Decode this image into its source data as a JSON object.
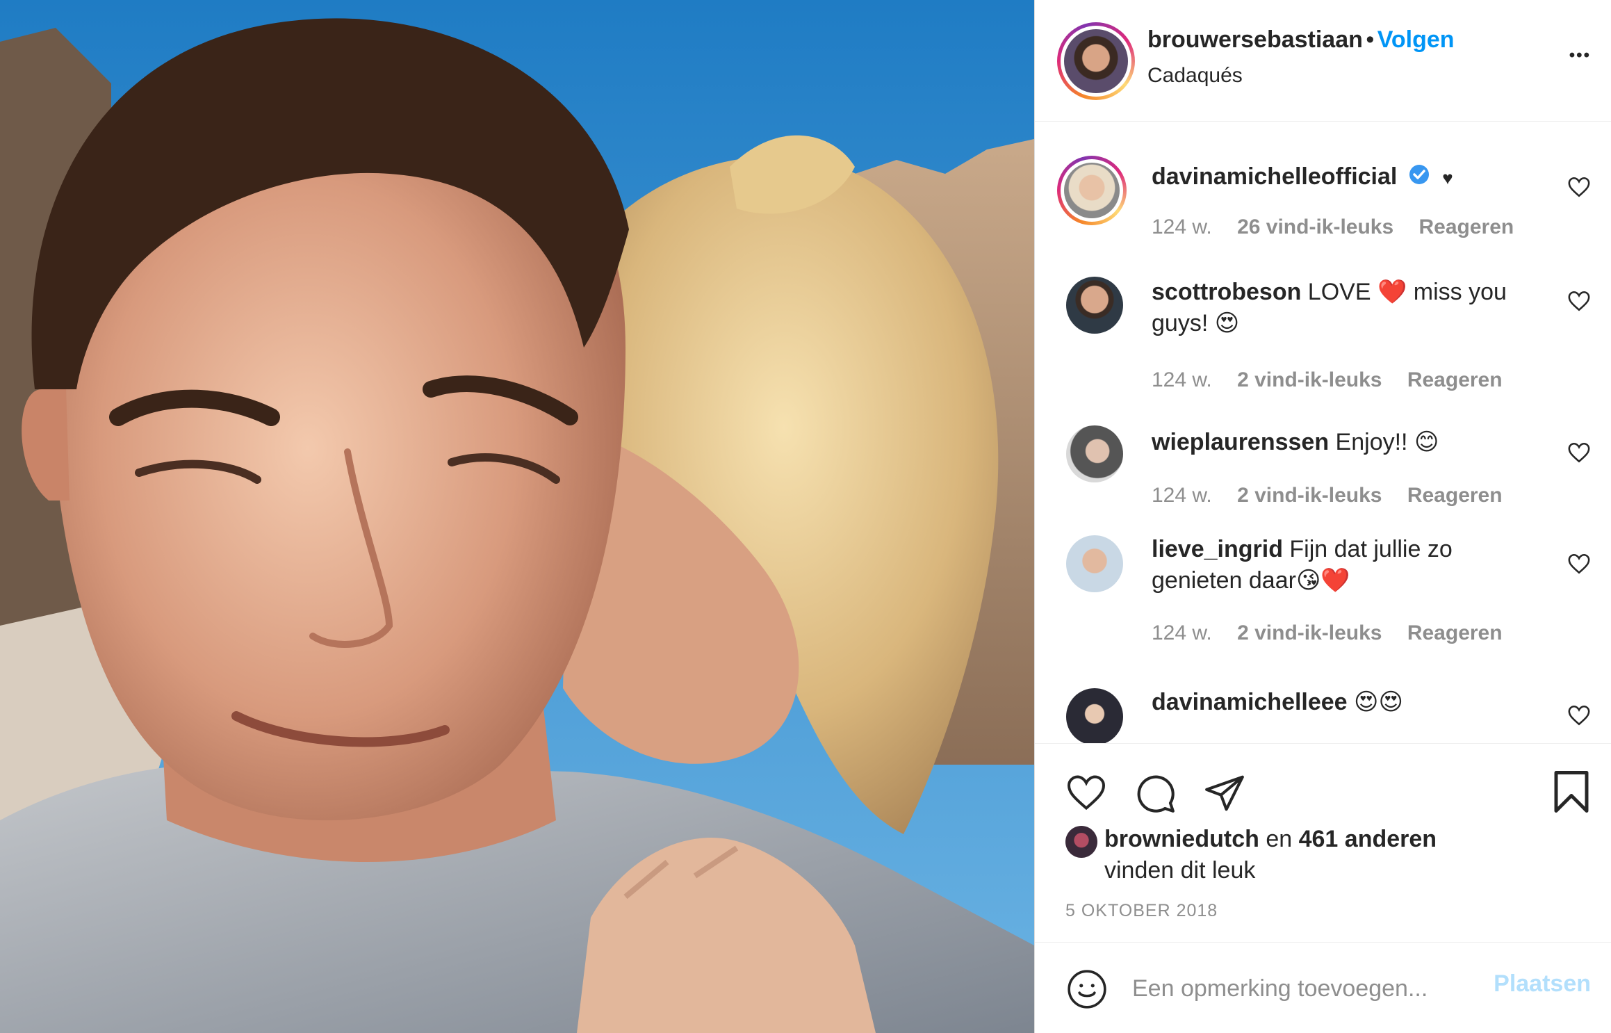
{
  "post": {
    "author": "brouwersebastiaan",
    "follow_label": "Volgen",
    "separator": "•",
    "location": "Cadaqués",
    "more_label": "•••"
  },
  "comments": [
    {
      "username": "davinamichelleofficial",
      "text": "",
      "verified": true,
      "extra": "♥",
      "time": "124 w.",
      "likes": "26 vind-ik-leuks",
      "reply": "Reageren"
    },
    {
      "username": "scottrobeson",
      "text": " LOVE ❤️ miss you guys! 😍",
      "time": "124 w.",
      "likes": "2 vind-ik-leuks",
      "reply": "Reageren"
    },
    {
      "username": "wieplaurenssen",
      "text": " Enjoy!! 😊",
      "time": "124 w.",
      "likes": "2 vind-ik-leuks",
      "reply": "Reageren"
    },
    {
      "username": "lieve_ingrid",
      "text": " Fijn dat jullie zo genieten daar😘❤️",
      "time": "124 w.",
      "likes": "2 vind-ik-leuks",
      "reply": "Reageren"
    },
    {
      "username": "davinamichelleee",
      "text": " 😍😍"
    }
  ],
  "likes": {
    "first_user": "browniedutch",
    "connector": " en ",
    "others": "461 anderen",
    "suffix": "vinden dit leuk"
  },
  "date": "5 OKTOBER 2018",
  "comment_box": {
    "placeholder": "Een opmerking toevoegen...",
    "post_label": "Plaatsen"
  },
  "colors": {
    "accent": "#0095f6",
    "muted": "#8e8e8e",
    "post_disabled": "#b2dffc",
    "verified": "#3897f0"
  }
}
